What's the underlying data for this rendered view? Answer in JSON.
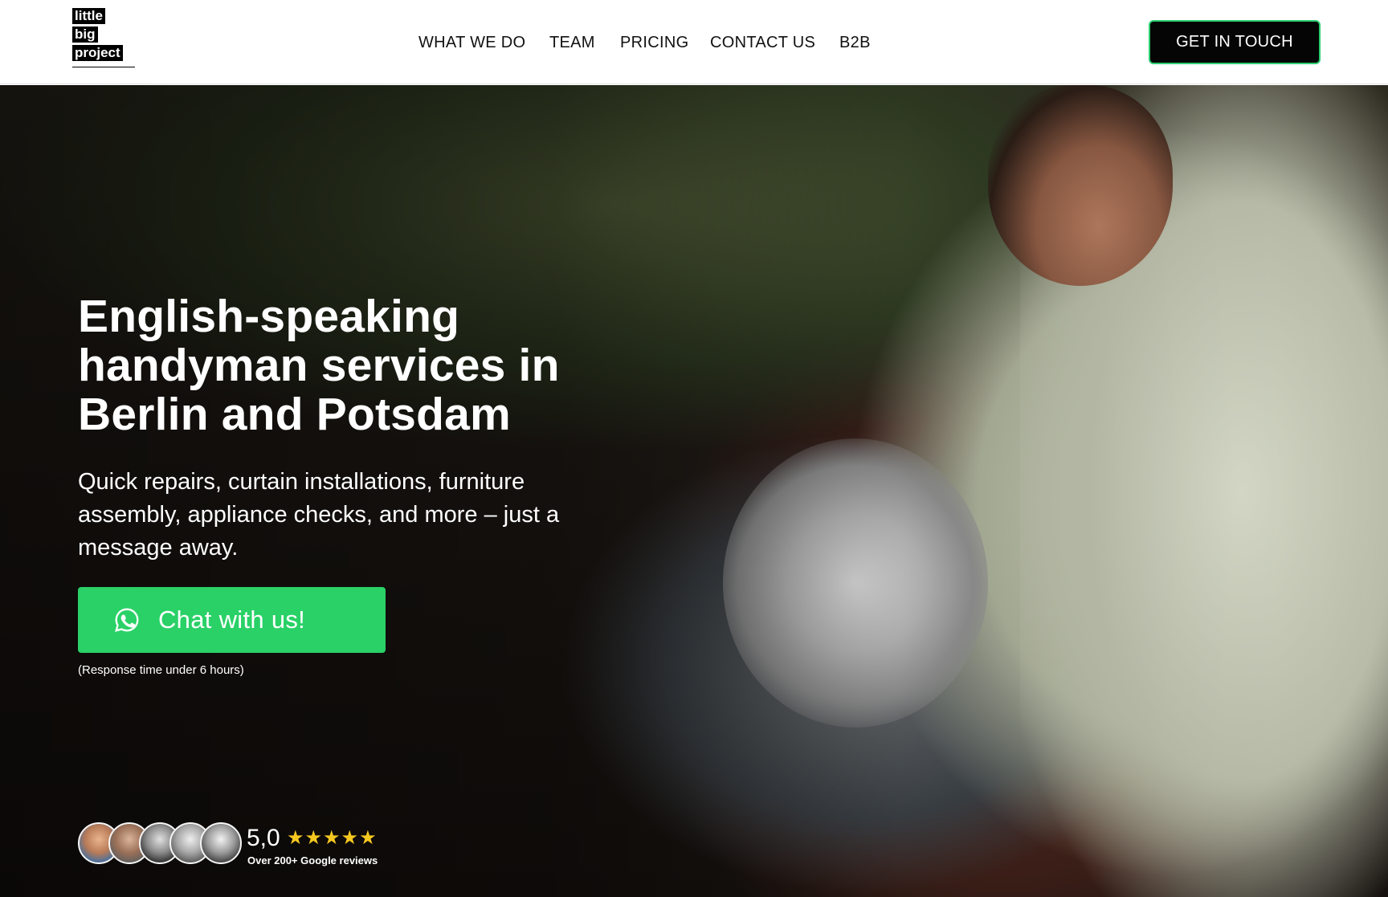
{
  "header": {
    "logo_words": [
      "little",
      "big",
      "project"
    ],
    "nav": [
      {
        "label": "WHAT WE DO"
      },
      {
        "label": "TEAM"
      },
      {
        "label": "PRICING"
      },
      {
        "label": "CONTACT US"
      },
      {
        "label": "B2B"
      }
    ],
    "cta_label": "GET IN TOUCH"
  },
  "hero": {
    "title_first": "English-speaking",
    "title_rest": "handyman services in Berlin and Potsdam",
    "subtitle": "Quick repairs, curtain installations, furniture assembly, appliance checks, and more – just a message away.",
    "chat_button_label": "Chat with us!",
    "chat_icon": "whatsapp-icon",
    "response_note": "(Response time under 6 hours)",
    "rating": {
      "value": "5,0",
      "stars": 5,
      "star_glyphs": "★★★★★",
      "reviews_label": "Over 200+ Google reviews"
    }
  },
  "colors": {
    "accent_green": "#2ad167",
    "cta_border": "#2ecc71",
    "star": "#f6c81f",
    "text_dark": "#111111"
  }
}
